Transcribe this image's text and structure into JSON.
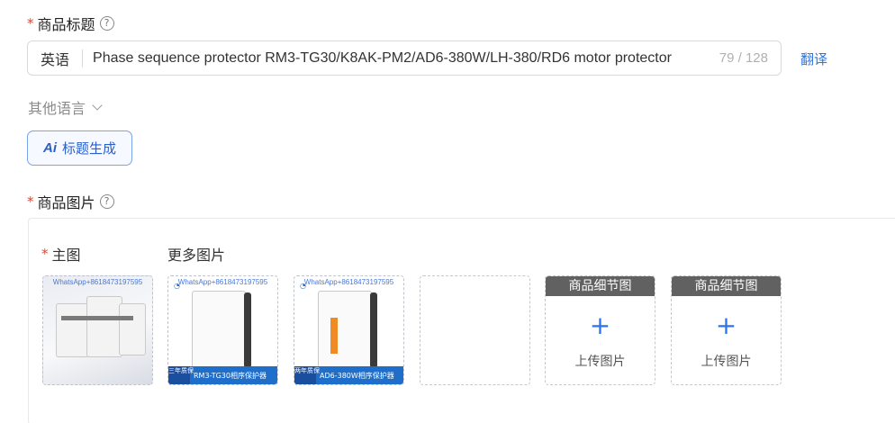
{
  "title_section": {
    "label": "商品标题",
    "help": "?",
    "language": "英语",
    "value": "Phase sequence protector RM3-TG30/K8AK-PM2/AD6-380W/LH-380/RD6 motor protector",
    "counter": "79 / 128",
    "translate": "翻译",
    "other_languages": "其他语言",
    "ai_button": "标题生成",
    "ai_icon_text": "Ai"
  },
  "images_section": {
    "label": "商品图片",
    "help": "?",
    "main_label": "主图",
    "more_label": "更多图片",
    "photos": [
      {
        "watermark": "WhatsApp+8618473197595"
      },
      {
        "watermark": "WhatsApp+8618473197595",
        "badge": "三年质保",
        "caption": "RM3-TG30相序保护器"
      },
      {
        "watermark": "WhatsApp+8618473197595",
        "badge": "两年质保",
        "caption": "AD6-380W相序保护器"
      }
    ],
    "detail_slots": [
      {
        "header": "商品细节图",
        "plus": "+",
        "upload": "上传图片"
      },
      {
        "header": "商品细节图",
        "plus": "+",
        "upload": "上传图片"
      }
    ]
  },
  "colors": {
    "accent": "#2a76e6",
    "required": "#e8412b",
    "caption_bar": "#1f6ec9"
  }
}
